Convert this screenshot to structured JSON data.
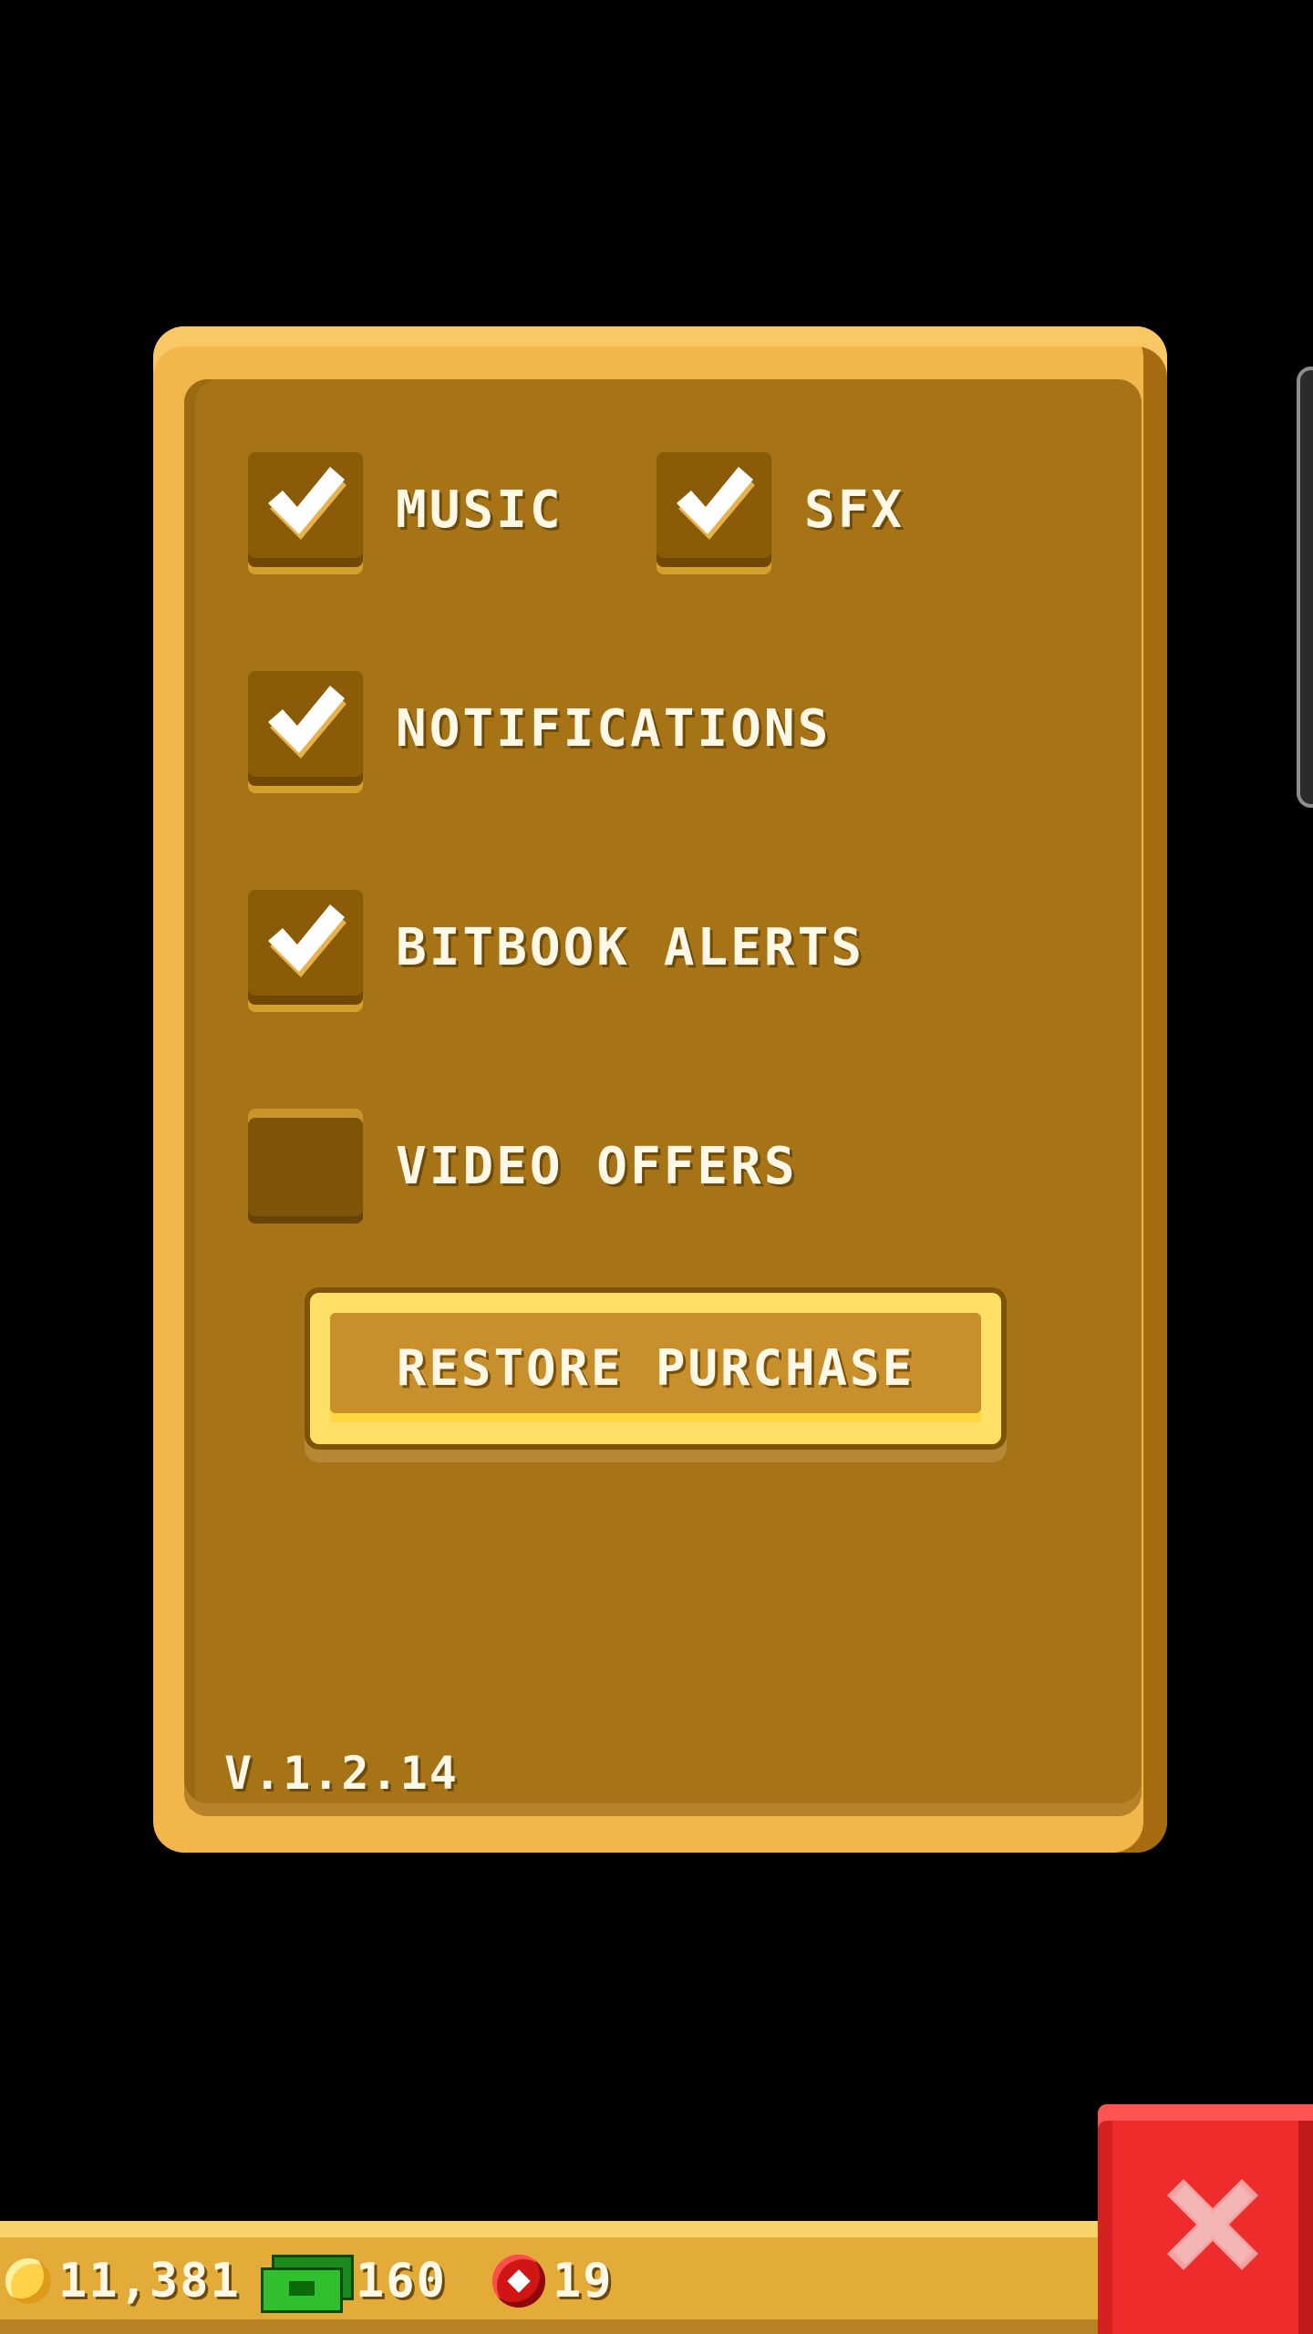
{
  "settings": {
    "music": {
      "label": "MUSIC",
      "checked": true
    },
    "sfx": {
      "label": "SFX",
      "checked": true
    },
    "notifications": {
      "label": "NOTIFICATIONS",
      "checked": true
    },
    "bitbook_alerts": {
      "label": "BITBOOK ALERTS",
      "checked": true
    },
    "video_offers": {
      "label": "VIDEO OFFERS",
      "checked": false
    },
    "restore_label": "RESTORE PURCHASE",
    "version": "V.1.2.14"
  },
  "currency": {
    "coins": "11,381",
    "bux": "160",
    "gems": "19"
  },
  "icons": {
    "coin": "coin-icon",
    "bux": "bux-icon",
    "gem": "gem-icon",
    "check": "checkmark-icon",
    "close": "close-icon"
  },
  "colors": {
    "panel_outer": "#f2b64a",
    "panel_inner": "#a67416",
    "close_button": "#ef2c2c",
    "text": "#fff8e6"
  }
}
